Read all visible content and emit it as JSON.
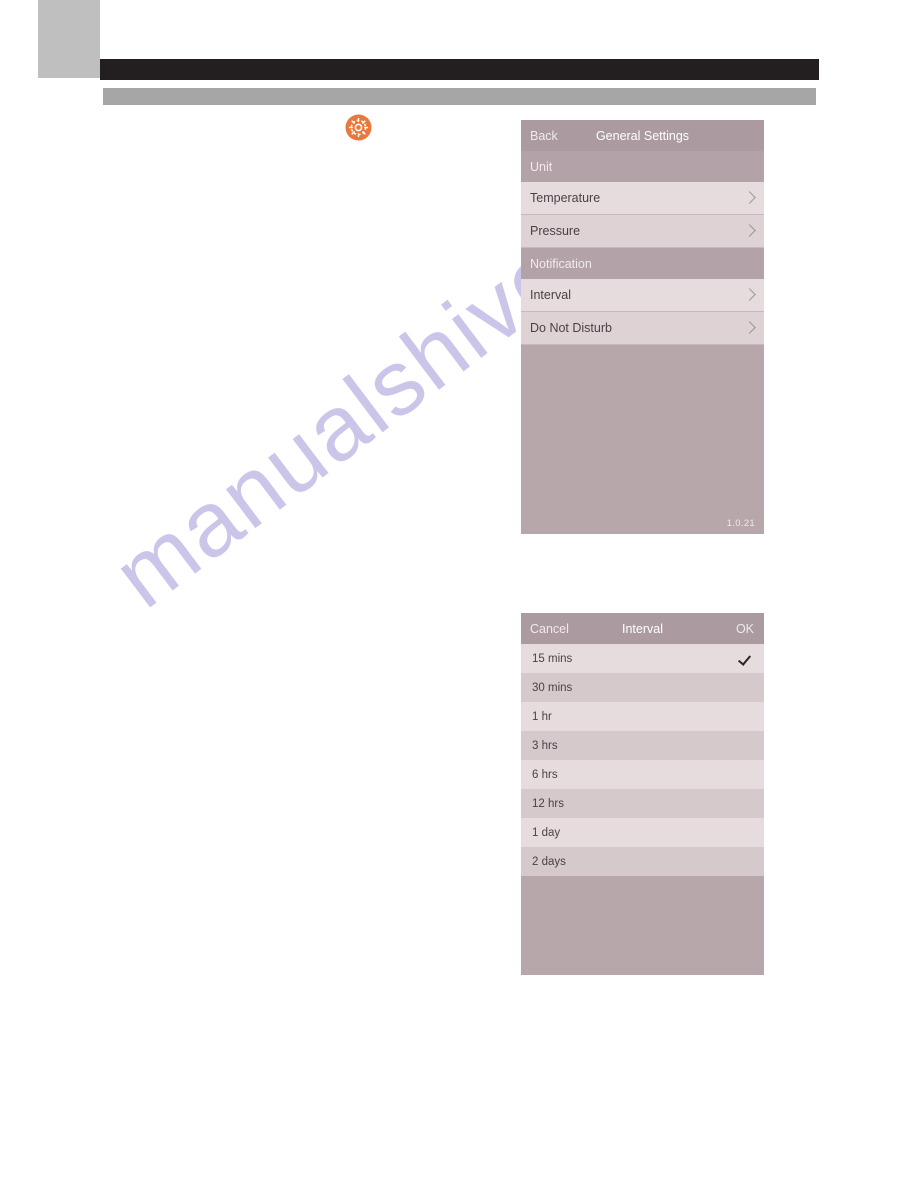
{
  "page": {
    "watermark_text": "manualshive.com"
  },
  "decor": {
    "corner_block_color": "#bfbfbf",
    "black_bar_color": "#231f20",
    "gray_bar_color": "#a6a6a6"
  },
  "gear": {
    "name": "settings-gear-icon",
    "color": "#e8783c"
  },
  "settings_screen": {
    "header": {
      "back_label": "Back",
      "title": "General Settings",
      "right_label": ""
    },
    "sections": [
      {
        "title": "Unit",
        "rows": [
          {
            "label": "Temperature",
            "accessory": "chevron-right"
          },
          {
            "label": "Pressure",
            "accessory": "chevron-right"
          }
        ]
      },
      {
        "title": "Notification",
        "rows": [
          {
            "label": "Interval",
            "accessory": "chevron-right"
          },
          {
            "label": "Do Not Disturb",
            "accessory": "chevron-right"
          }
        ]
      }
    ],
    "version": "1.0.21"
  },
  "interval_screen": {
    "header": {
      "cancel_label": "Cancel",
      "title": "Interval",
      "ok_label": "OK"
    },
    "options": [
      {
        "label": "15 mins",
        "selected": true
      },
      {
        "label": "30 mins",
        "selected": false
      },
      {
        "label": "1 hr",
        "selected": false
      },
      {
        "label": "3 hrs",
        "selected": false
      },
      {
        "label": "6 hrs",
        "selected": false
      },
      {
        "label": "12 hrs",
        "selected": false
      },
      {
        "label": "1 day",
        "selected": false
      },
      {
        "label": "2 days",
        "selected": false
      }
    ]
  },
  "colors": {
    "header_bar": "#ab9ba0",
    "section_head": "#b3a2a7",
    "row_light": "#e7dcdd",
    "row_dark": "#d6c9cc",
    "panel_filler": "#b7a7ab",
    "accent_orange": "#e8783c",
    "watermark": "#c9c4e8"
  }
}
